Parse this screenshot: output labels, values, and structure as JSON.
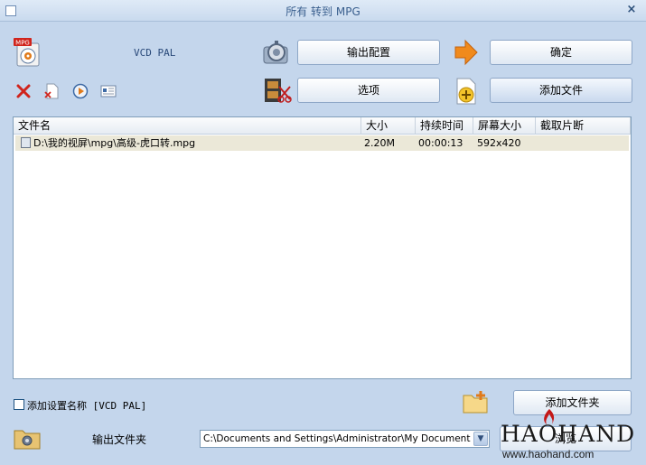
{
  "window": {
    "title": "所有 转到 MPG",
    "close_symbol": "×"
  },
  "profile": {
    "name": "VCD PAL",
    "badge": "MPG"
  },
  "buttons": {
    "output_config": "输出配置",
    "ok": "确定",
    "options": "选项",
    "add_file": "添加文件",
    "add_folder": "添加文件夹",
    "browse": "浏览"
  },
  "list": {
    "columns": [
      "文件名",
      "大小",
      "持续时间",
      "屏幕大小",
      "截取片断"
    ],
    "rows": [
      {
        "filename": "D:\\我的视屏\\mpg\\高级-虎口转.mpg",
        "size": "2.20M",
        "duration": "00:00:13",
        "screen": "592x420",
        "clip": ""
      }
    ]
  },
  "options": {
    "add_setting_name_label": "添加设置名称 [VCD PAL]",
    "add_setting_name_checked": false
  },
  "output": {
    "folder_label": "输出文件夹",
    "path": "C:\\Documents and Settings\\Administrator\\My Documents\\FFO"
  },
  "watermark": {
    "brand": "HAOHAND",
    "url": "www.haohand.com"
  },
  "icons": {
    "remove": "delete-x-icon",
    "clear": "clear-list-icon",
    "play": "play-icon",
    "info": "media-info-icon",
    "settings": "settings-cog-icon",
    "arrow": "right-arrow-icon",
    "film": "film-scissors-icon",
    "add": "add-file-icon",
    "folder": "folder-add-icon",
    "output_folder": "output-folder-icon"
  },
  "colors": {
    "background": "#c4d6ec",
    "accent_orange": "#f08a1c",
    "delete_red": "#d0241c",
    "selected_row": "#ebe8d8"
  }
}
